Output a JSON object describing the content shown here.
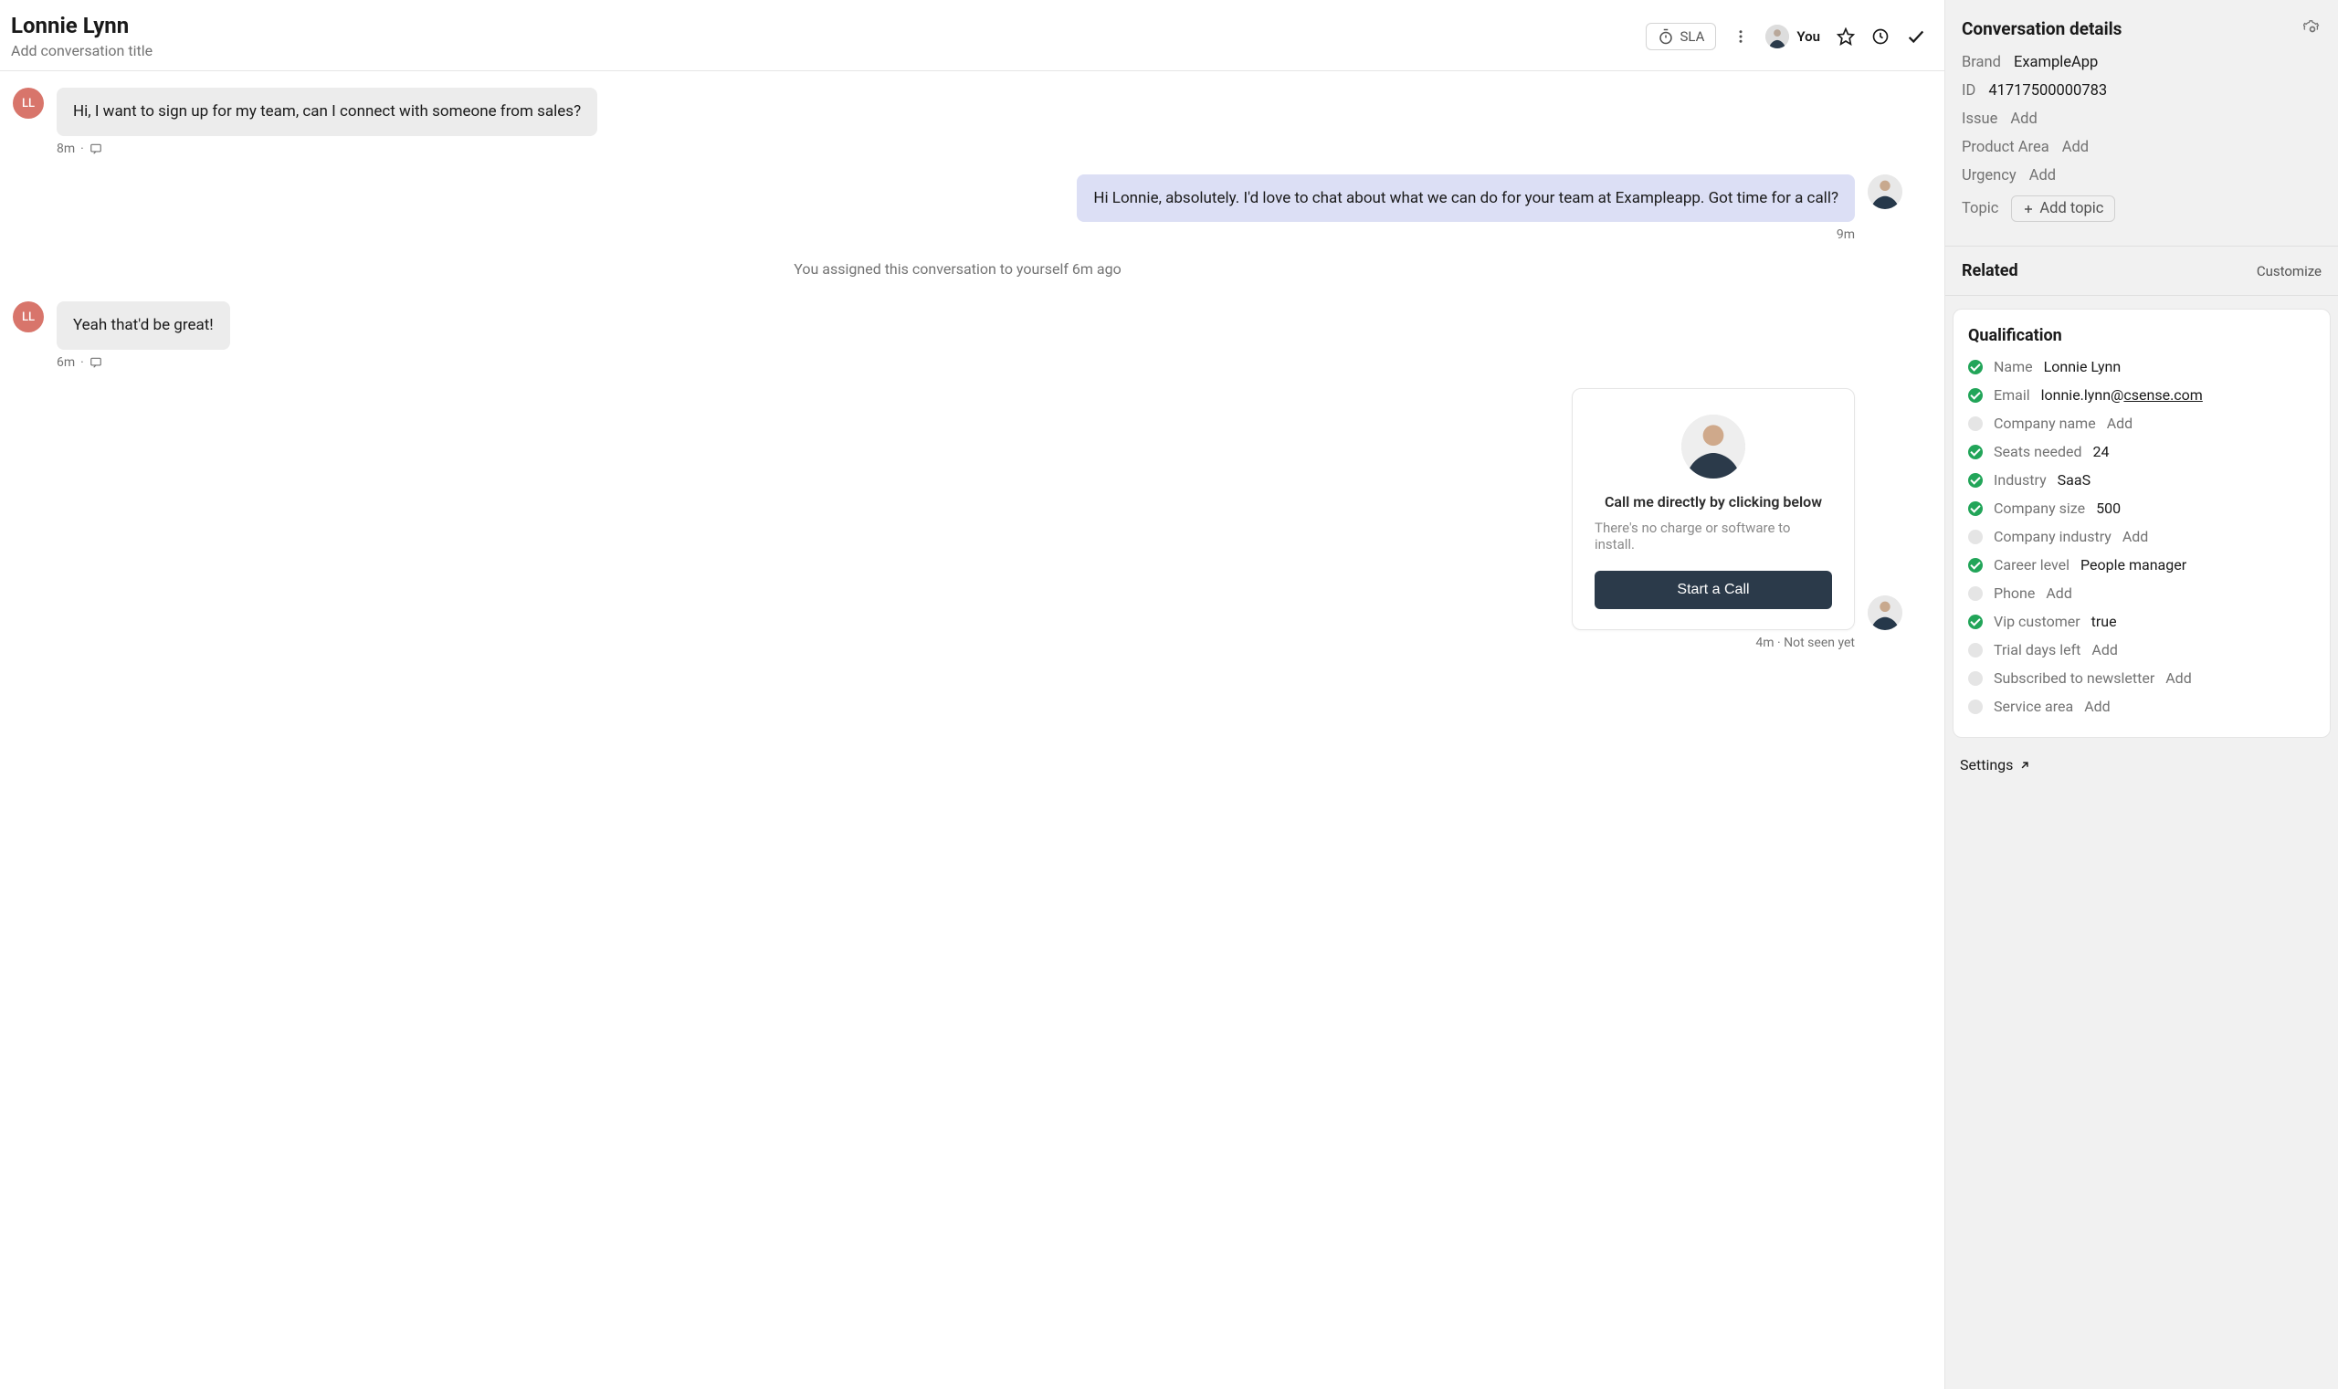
{
  "header": {
    "contact_name": "Lonnie Lynn",
    "title_placeholder": "Add conversation title",
    "sla_label": "SLA",
    "assignee_label": "You",
    "contact_initials": "LL"
  },
  "thread": {
    "msg1": {
      "text": "Hi, I want to sign up for my team, can I connect with someone from sales?",
      "meta": "8m"
    },
    "msg2": {
      "text": "Hi Lonnie, absolutely. I'd love to chat about what we can do for your team at Exampleapp. Got time for a call?",
      "meta": "9m"
    },
    "system": "You assigned this conversation to yourself 6m ago",
    "msg3": {
      "text": "Yeah that'd be great!",
      "meta": "6m"
    },
    "call_card": {
      "title": "Call me directly by clicking below",
      "subtitle": "There's no charge or software to install.",
      "button": "Start a Call"
    },
    "msg4_meta": "4m · Not seen yet"
  },
  "details": {
    "section_title": "Conversation details",
    "brand": {
      "label": "Brand",
      "value": "ExampleApp"
    },
    "id": {
      "label": "ID",
      "value": "41717500000783"
    },
    "issue": {
      "label": "Issue",
      "add": "Add"
    },
    "product_area": {
      "label": "Product Area",
      "add": "Add"
    },
    "urgency": {
      "label": "Urgency",
      "add": "Add"
    },
    "topic": {
      "label": "Topic",
      "add_button": "Add topic"
    }
  },
  "related": {
    "title": "Related",
    "customize": "Customize"
  },
  "qualification": {
    "title": "Qualification",
    "rows": [
      {
        "status": "done",
        "label": "Name",
        "value": "Lonnie Lynn"
      },
      {
        "status": "done",
        "label": "Email",
        "value_prefix": "lonnie.lynn@",
        "value_link": "csense.com"
      },
      {
        "status": "empty",
        "label": "Company name",
        "add": "Add"
      },
      {
        "status": "done",
        "label": "Seats needed",
        "value": "24"
      },
      {
        "status": "done",
        "label": "Industry",
        "value": "SaaS"
      },
      {
        "status": "done",
        "label": "Company size",
        "value": "500"
      },
      {
        "status": "empty",
        "label": "Company industry",
        "add": "Add"
      },
      {
        "status": "done",
        "label": "Career level",
        "value": "People manager"
      },
      {
        "status": "empty",
        "label": "Phone",
        "add": "Add"
      },
      {
        "status": "done",
        "label": "Vip customer",
        "value": "true"
      },
      {
        "status": "empty",
        "label": "Trial days left",
        "add": "Add"
      },
      {
        "status": "empty",
        "label": "Subscribed to newsletter",
        "add": "Add"
      },
      {
        "status": "empty",
        "label": "Service area",
        "add": "Add"
      }
    ],
    "settings": "Settings"
  }
}
